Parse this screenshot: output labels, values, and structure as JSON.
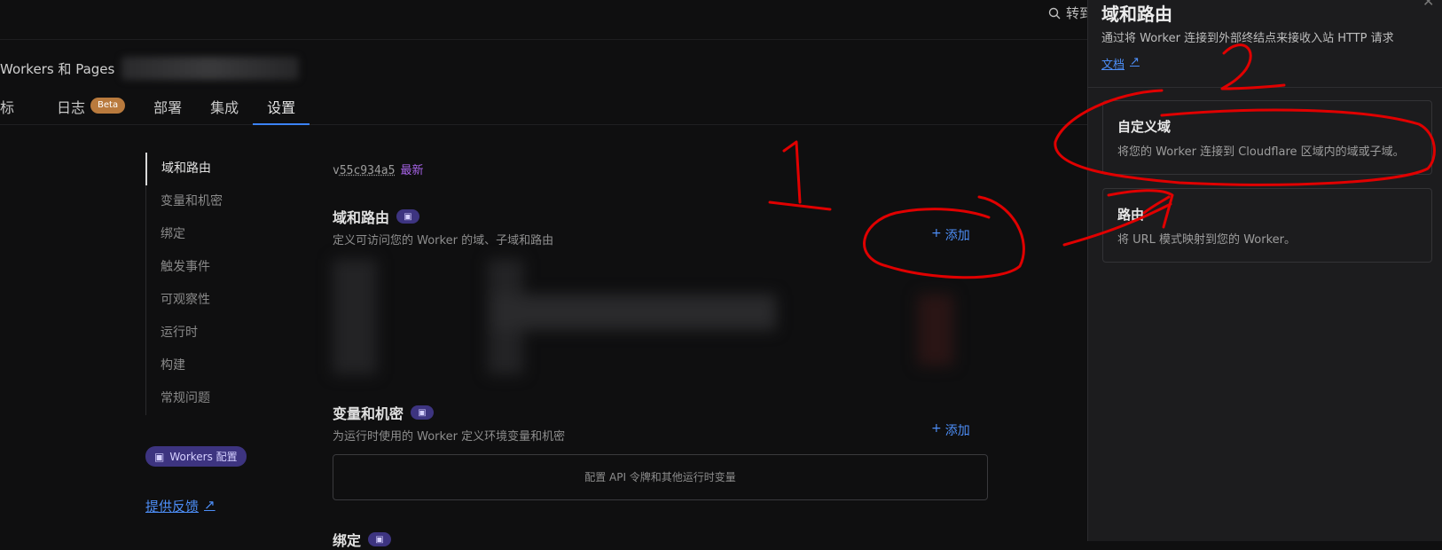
{
  "header": {
    "search_label": "转到",
    "breadcrumb_app": "Workers 和 Pages"
  },
  "tabs": [
    {
      "label": "标"
    },
    {
      "label": "日志",
      "badge": "Beta"
    },
    {
      "label": "部署"
    },
    {
      "label": "集成"
    },
    {
      "label": "设置",
      "active": true
    }
  ],
  "left_nav": {
    "items": [
      "域和路由",
      "变量和机密",
      "绑定",
      "触发事件",
      "可观察性",
      "运行时",
      "构建",
      "常规问题"
    ],
    "config_badge": "Workers 配置",
    "feedback": "提供反馈"
  },
  "main": {
    "version_prefix": "v",
    "version_id": "55c934a5",
    "version_tag": "最新",
    "domains": {
      "title": "域和路由",
      "desc": "定义可访问您的 Worker 的域、子域和路由",
      "add": "添加"
    },
    "variables": {
      "title": "变量和机密",
      "desc": "为运行时使用的 Worker 定义环境变量和机密",
      "add": "添加",
      "empty": "配置 API 令牌和其他运行时变量"
    },
    "bindings": {
      "title": "绑定"
    }
  },
  "panel": {
    "title": "域和路由",
    "desc": "通过将 Worker 连接到外部终结点来接收入站 HTTP 请求",
    "doc": "文档",
    "cards": [
      {
        "title": "自定义域",
        "desc": "将您的 Worker 连接到 Cloudflare 区域内的域或子域。"
      },
      {
        "title": "路由",
        "desc": "将 URL 模式映射到您的 Worker。"
      }
    ]
  },
  "annotations": {
    "label1": "1",
    "label2": "2",
    "color": "#e00000"
  },
  "colors": {
    "accent": "#4d8ef7",
    "panel_bg": "#1c1c1e",
    "page_bg": "#0f0f10",
    "purple": "#3d3480"
  }
}
